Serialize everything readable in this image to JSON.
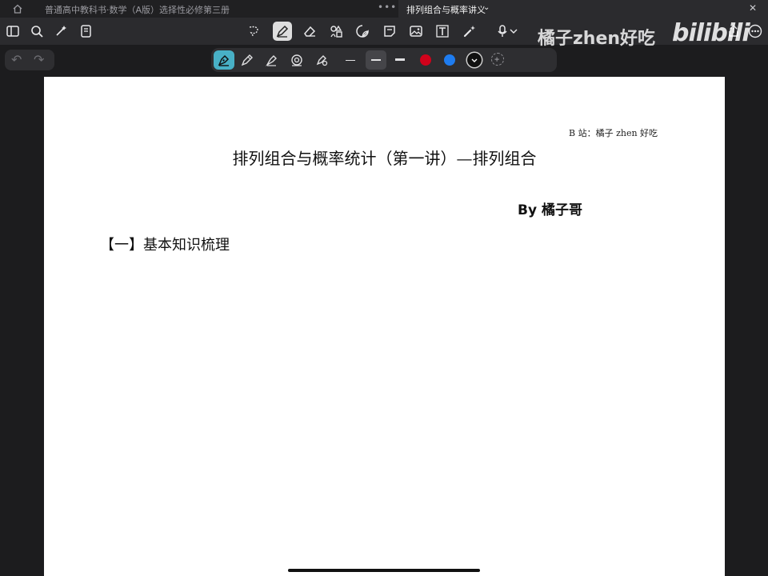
{
  "tabs": [
    {
      "label": "普通高中教科书·数学（A版）选择性必修第三册",
      "active": false
    },
    {
      "label": "排列组合与概率讲义",
      "active": true
    }
  ],
  "tab_more": "•••",
  "watermark": {
    "uploader": "橘子zhen好吃",
    "logo": "bilibili"
  },
  "colors": {
    "accent": "#48b0c6",
    "red": "#d0021b",
    "blue": "#1e7cf0",
    "black": "#111111"
  },
  "document": {
    "source": "B 站：橘子 zhen 好吃",
    "title": "排列组合与概率统计（第一讲）—排列组合",
    "author": "By  橘子哥",
    "section": "【一】基本知识梳理"
  }
}
